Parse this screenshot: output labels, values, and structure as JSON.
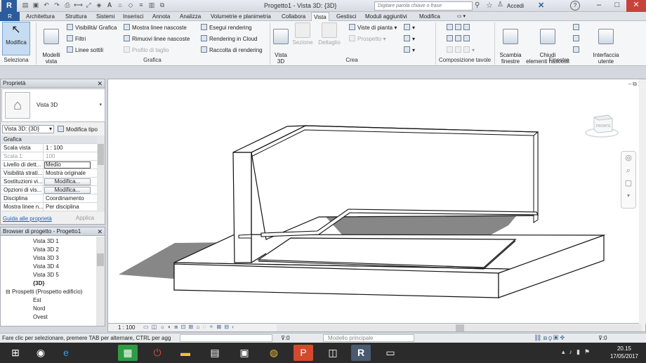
{
  "titlebar": {
    "app_logo": "R",
    "title": "Progetto1 - Vista 3D: {3D}",
    "search_placeholder": "Digitare parola chiave o frase",
    "signin_label": "Accedi",
    "help_label": "?"
  },
  "tabs": [
    "Architettura",
    "Struttura",
    "Sistemi",
    "Inserisci",
    "Annota",
    "Analizza",
    "Volumetrie e planimetria",
    "Collabora",
    "Vista",
    "Gestisci",
    "Moduli aggiuntivi",
    "Modifica"
  ],
  "active_tab": "Vista",
  "ribbon": {
    "modifica": "Modifica",
    "seleziona": "Seleziona",
    "modelli_vista": "Modelli\nvista",
    "grafica_small": {
      "visibility": "Visibilità/ Grafica",
      "filters": "Filtri",
      "thin_lines": "Linee sottili",
      "show_hidden": "Mostra linee nascoste",
      "remove_hidden": "Rimuovi linee nascoste",
      "cut_profile": "Profilo di taglio"
    },
    "render_small": {
      "render": "Esegui rendering",
      "render_cloud": "Rendering  in Cloud",
      "render_gallery": "Raccolta  di rendering"
    },
    "grafica_label": "Grafica",
    "crea": {
      "vista3d": "Vista\n3D",
      "sezione": "Sezione",
      "dettaglio": "Dettaglio",
      "viste_pianta": "Viste di pianta",
      "prospetto": "Prospetto"
    },
    "crea_label": "Crea",
    "composizione_label": "Composizione tavole",
    "finestre": {
      "scambia": "Scambia\nfinestre",
      "chiudi": "Chiudi\nelementi nascosti",
      "interfaccia": "Interfaccia\nutente"
    },
    "finestre_label": "Finestre"
  },
  "properties": {
    "title": "Proprietà",
    "type_name": "Vista 3D",
    "instance": "Vista 3D: {3D}",
    "edit_type": "Modifica tipo",
    "rows": [
      {
        "name": "Grafica",
        "value": "",
        "kind": "cat"
      },
      {
        "name": "Scala vista",
        "value": "1 : 100",
        "kind": "text"
      },
      {
        "name": "Scala  1:",
        "value": "100",
        "kind": "muted"
      },
      {
        "name": "Livello di dett...",
        "value": "Medio",
        "kind": "box"
      },
      {
        "name": "Visibilità strati...",
        "value": "Mostra originale",
        "kind": "text"
      },
      {
        "name": "Sostituzioni vi...",
        "value": "Modifica...",
        "kind": "btn"
      },
      {
        "name": "Opzioni di vis...",
        "value": "Modifica...",
        "kind": "btn"
      },
      {
        "name": "Disciplina",
        "value": "Coordinamento",
        "kind": "text"
      },
      {
        "name": "Mostra linee n...",
        "value": "Per disciplina",
        "kind": "text"
      }
    ],
    "help_link": "Guida alle proprietà",
    "apply": "Applica"
  },
  "browser": {
    "title": "Browser di progetto - Progetto1",
    "items": [
      {
        "label": "Vista 3D 1",
        "indent": 3,
        "bold": false
      },
      {
        "label": "Vista 3D 2",
        "indent": 3,
        "bold": false
      },
      {
        "label": "Vista 3D 3",
        "indent": 3,
        "bold": false
      },
      {
        "label": "Vista 3D 4",
        "indent": 3,
        "bold": false
      },
      {
        "label": "Vista 3D 5",
        "indent": 3,
        "bold": false
      },
      {
        "label": "{3D}",
        "indent": 3,
        "bold": true
      },
      {
        "label": "Prospetti (Prospetto edificio)",
        "indent": 1,
        "bold": false,
        "expander": "−"
      },
      {
        "label": "Est",
        "indent": 3,
        "bold": false
      },
      {
        "label": "Nord",
        "indent": 3,
        "bold": false
      },
      {
        "label": "Ovest",
        "indent": 3,
        "bold": false
      }
    ]
  },
  "viewport": {
    "viewcube_face": "FRONTE"
  },
  "viewbar": {
    "scale": "1 : 100"
  },
  "statusbar": {
    "message": "Fare clic per selezionare, premere TAB per alternare, CTRL per agg",
    "filter_value": ":0",
    "model": "Modello principale",
    "selection_count": ":0"
  },
  "taskbar": {
    "time": "20.15",
    "date": "17/05/2017"
  },
  "colors": {
    "file_tab": "#2b5b9a",
    "accent_blue": "#1a5fb4",
    "close_red": "#c9423b",
    "shadow": "#878787"
  }
}
